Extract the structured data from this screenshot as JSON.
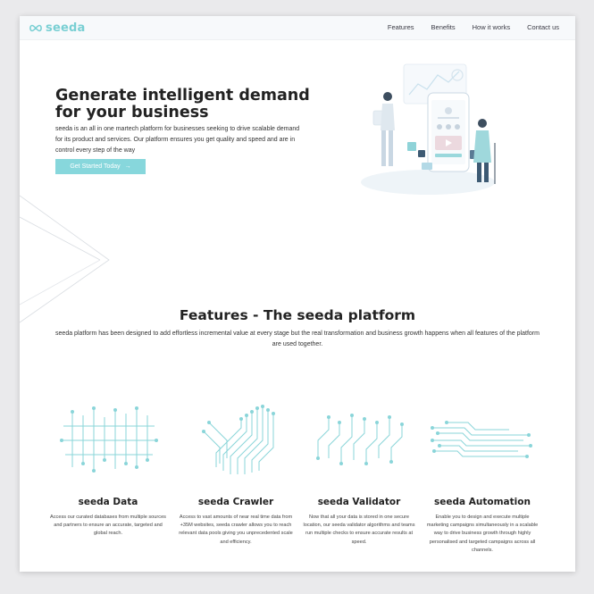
{
  "brand": {
    "name": "seeda",
    "accent": "#79cfd3",
    "button_color": "#87d7dc"
  },
  "nav": [
    "Features",
    "Benefits",
    "How it works",
    "Contact us"
  ],
  "hero": {
    "title": "Generate intelligent demand for your business",
    "description": "seeda is an all in one martech platform for businesses seeking to drive scalable demand for its product and services. Our platform ensures you get quality and speed and are in control every step of the way",
    "cta_label": "Get Started Today",
    "cta_icon": "arrow-right-icon"
  },
  "features": {
    "title": "Features - The seeda platform",
    "subtitle": "seeda platform has been designed to add effortless incremental value at every stage but the real transformation and business growth happens when all features of the platform are used together.",
    "items": [
      {
        "title": "seeda Data",
        "icon": "circuit-data-icon",
        "description": "Access our curated databases from multiple sources and partners to ensure an accurate, targeted and global reach."
      },
      {
        "title": "seeda Crawler",
        "icon": "circuit-crawler-icon",
        "description": "Access to vast amounts of near real time data from +35M websites, seeda crawler allows you to reach relevant data pools giving you unprecedented scale and efficiency."
      },
      {
        "title": "seeda Validator",
        "icon": "circuit-validator-icon",
        "description": "Now that all your data is stored in one secure location, our seeda validator algorithms and teams run multiple checks to ensure accurate results at speed."
      },
      {
        "title": "seeda Automation",
        "icon": "circuit-automation-icon",
        "description": "Enable you to design and execute multiple marketing campaigns simultaneously in a scalable way to drive business growth through highly personalised and targeted campaigns across all channels."
      }
    ]
  }
}
